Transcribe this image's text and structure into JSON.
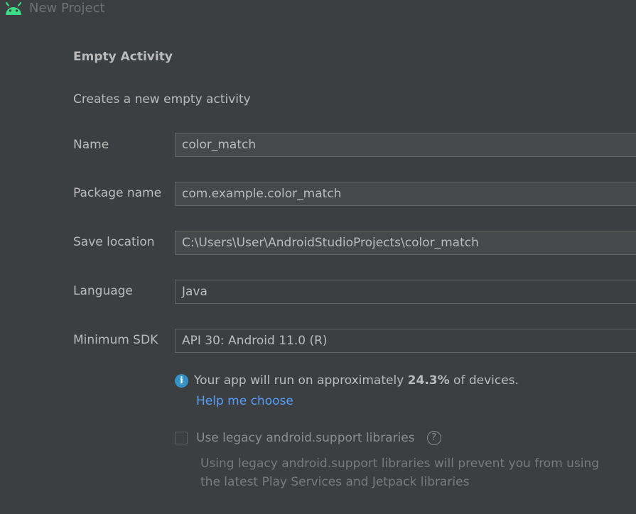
{
  "window": {
    "title": "New Project",
    "icon": "android-icon"
  },
  "template": {
    "heading": "Empty Activity",
    "description": "Creates a new empty activity"
  },
  "form": {
    "name": {
      "label": "Name",
      "value": "color_match"
    },
    "package": {
      "label": "Package name",
      "value": "com.example.color_match"
    },
    "save_location": {
      "label": "Save location",
      "value": "C:\\Users\\User\\AndroidStudioProjects\\color_match"
    },
    "language": {
      "label": "Language",
      "value": "Java"
    },
    "min_sdk": {
      "label": "Minimum SDK",
      "value": "API 30: Android 11.0 (R)"
    }
  },
  "sdk_info": {
    "icon": "info-icon",
    "text_before": "Your app will run on approximately ",
    "percentage": "24.3%",
    "text_after": " of devices.",
    "help_link": "Help me choose"
  },
  "legacy": {
    "checkbox_label": "Use legacy android.support libraries",
    "checked": false,
    "help_icon": "question-icon",
    "description_line1": "Using legacy android.support libraries will prevent you from using",
    "description_line2": "the latest Play Services and Jetpack libraries"
  },
  "colors": {
    "background": "#3c3f41",
    "field_background": "#45494a",
    "link": "#589df6",
    "info_icon": "#3592c4",
    "android_green": "#3ddc84"
  }
}
